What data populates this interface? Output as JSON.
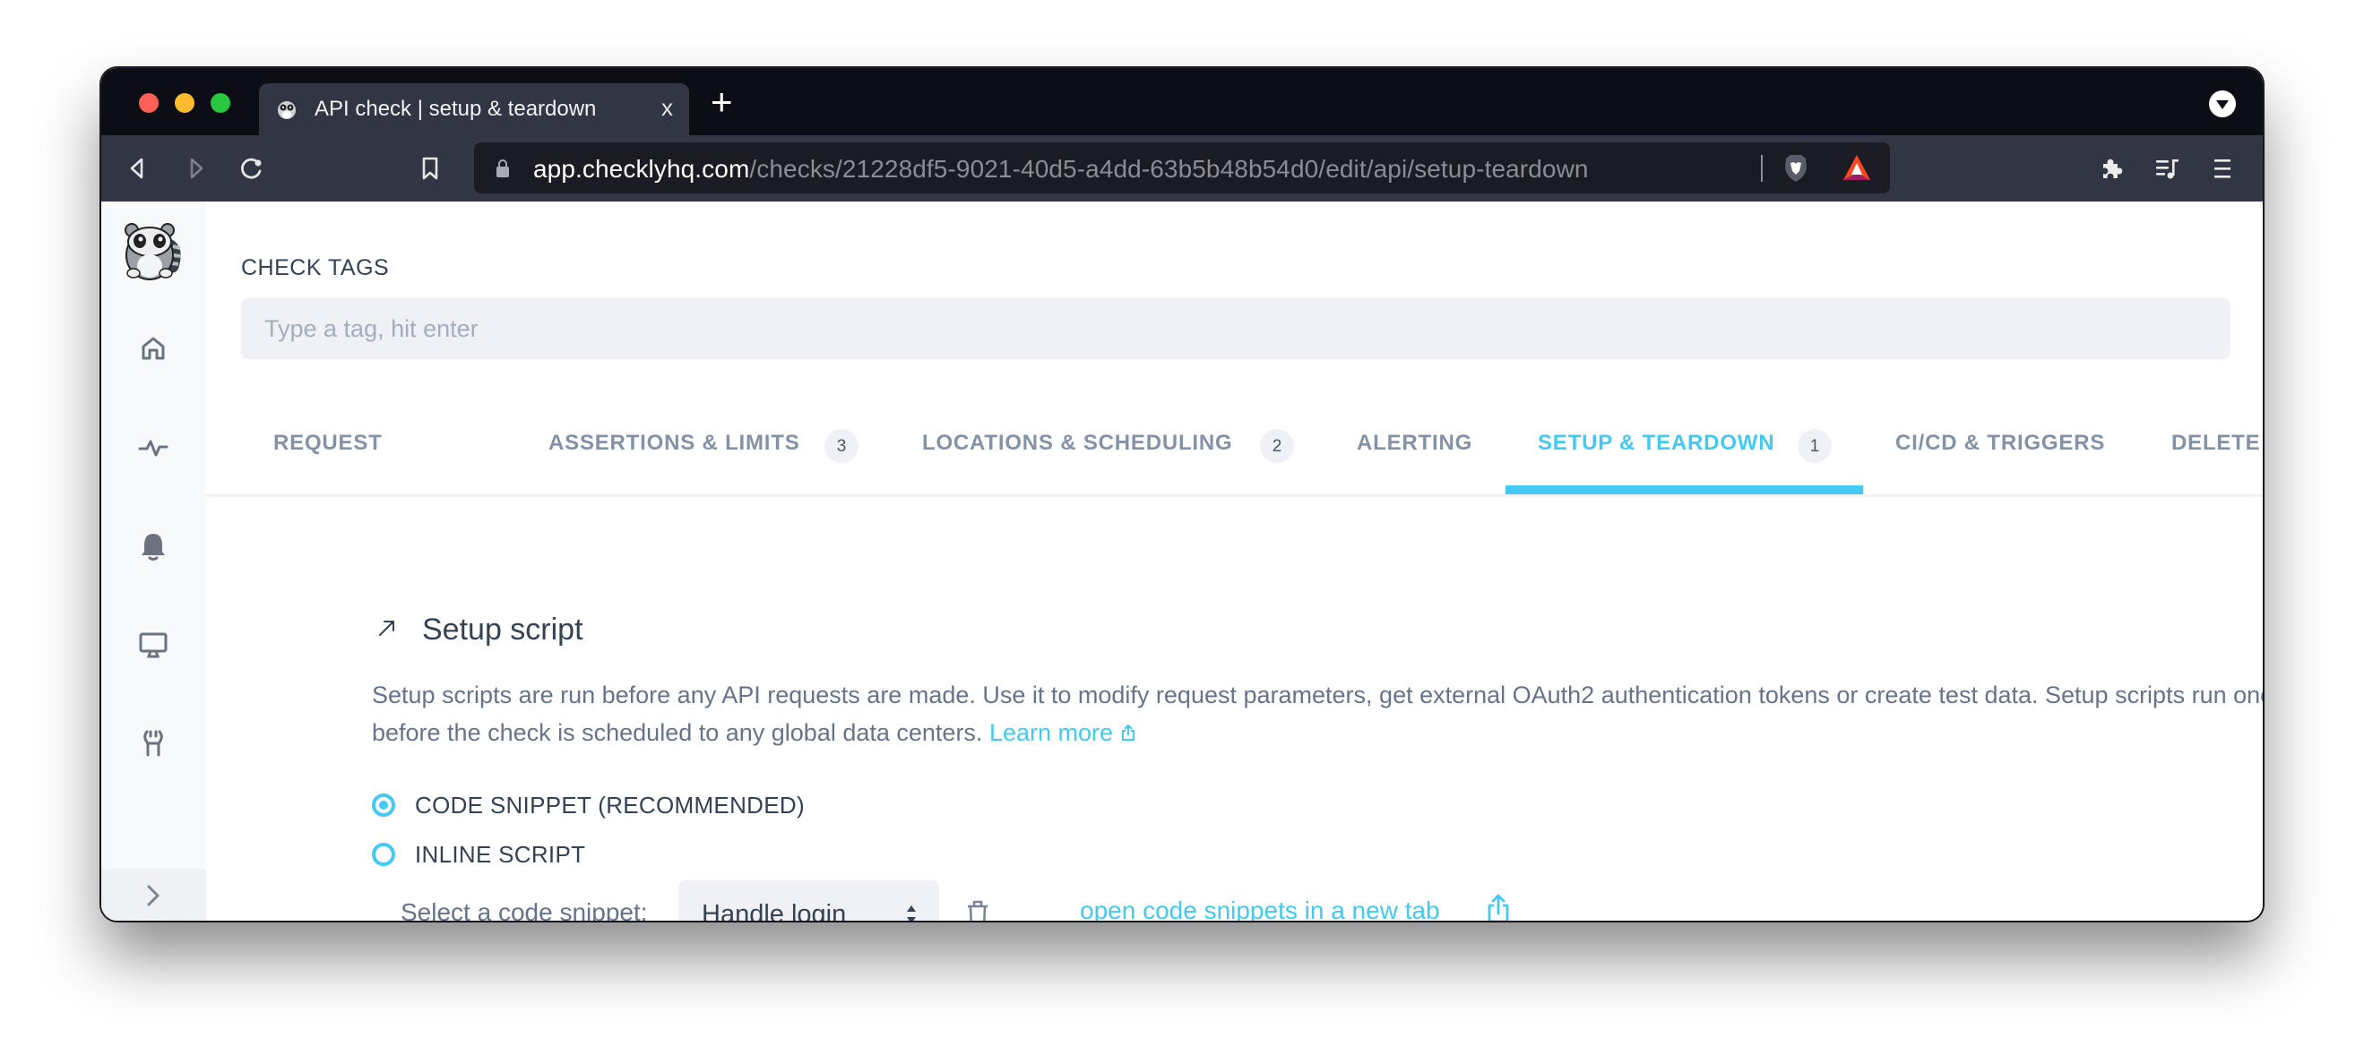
{
  "browser": {
    "tab_title": "API check | setup & teardown",
    "tab_close": "x",
    "new_tab": "+",
    "url_host": "app.checklyhq.com",
    "url_path": "/checks/21228df5-9021-40d5-a4dd-63b5b48b54d0/edit/api/setup-teardown"
  },
  "sidebar": {
    "items": [
      {
        "name": "home",
        "icon": "home-icon"
      },
      {
        "name": "checks",
        "icon": "pulse-icon"
      },
      {
        "name": "alerts",
        "icon": "bell-icon"
      },
      {
        "name": "dashboards",
        "icon": "monitor-icon"
      },
      {
        "name": "settings",
        "icon": "wrench-icon"
      }
    ],
    "collapse_icon": "chevron-right-icon"
  },
  "tags": {
    "label": "CHECK TAGS",
    "placeholder": "Type a tag, hit enter",
    "value": ""
  },
  "tabs": [
    {
      "label": "REQUEST",
      "badge": null,
      "active": false
    },
    {
      "label": "ASSERTIONS & LIMITS",
      "badge": "3",
      "active": false
    },
    {
      "label": "LOCATIONS & SCHEDULING",
      "badge": "2",
      "active": false
    },
    {
      "label": "ALERTING",
      "badge": null,
      "active": false
    },
    {
      "label": "SETUP & TEARDOWN",
      "badge": "1",
      "active": true
    },
    {
      "label": "CI/CD & TRIGGERS",
      "badge": null,
      "active": false
    },
    {
      "label": "DELETE",
      "badge": null,
      "active": false
    }
  ],
  "setup": {
    "title": "Setup script",
    "description": "Setup scripts are run before any API requests are made. Use it to modify request parameters, get external OAuth2 authentication tokens or create test data. Setup scripts run once before the check is scheduled to any global data centers.",
    "learn_more": "Learn more",
    "options": [
      {
        "label": "CODE SNIPPET (RECOMMENDED)",
        "checked": true
      },
      {
        "label": "INLINE SCRIPT",
        "checked": false
      }
    ],
    "select_label": "Select a code snippet:",
    "selected_snippet": "Handle login",
    "open_snippets_link": "open code snippets in a new tab"
  },
  "colors": {
    "accent": "#45c8f1",
    "text_dark": "#364152",
    "text_muted": "#8492a6",
    "titlebar": "#0d0e15",
    "toolbar": "#323543"
  }
}
